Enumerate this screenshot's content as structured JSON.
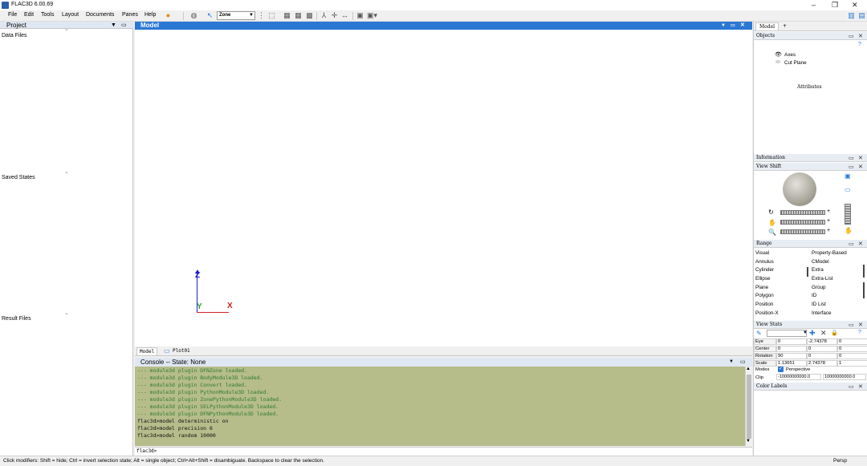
{
  "window": {
    "title": "FLAC3D 6.00.69"
  },
  "menu": [
    "File",
    "Edit",
    "Tools",
    "Layout",
    "Documents",
    "Panes",
    "Help"
  ],
  "toolbar": {
    "select_value": "Zone"
  },
  "project": {
    "title": "Project",
    "sections": [
      "Data Files",
      "Saved States",
      "Result Files"
    ]
  },
  "model": {
    "title": "Model",
    "axes": {
      "z": "Z",
      "y": "Y",
      "x": "X"
    },
    "colors": {
      "z": "#1a1ad8",
      "y": "#2ca02c",
      "x": "#d62020"
    }
  },
  "view_tabs": [
    "Model",
    "Plot01"
  ],
  "console": {
    "title": "Console -- State: None",
    "lines": [
      {
        "text": "--- module3d plugin DFNZone loaded.",
        "kind": "g"
      },
      {
        "text": "--- module3d plugin BodyModule3D loaded.",
        "kind": "g"
      },
      {
        "text": "--- module3d plugin Convert loaded.",
        "kind": "g"
      },
      {
        "text": "--- module3d plugin PythonModule3D loaded.",
        "kind": "g"
      },
      {
        "text": "--- module3d plugin ZonePythonModule3D loaded.",
        "kind": "g"
      },
      {
        "text": "--- module3d plugin SELPythonModule3D loaded.",
        "kind": "g"
      },
      {
        "text": "--- module3d plugin DFNPythonModule3D loaded.",
        "kind": "g"
      },
      {
        "text": "flac3d>model deterministic on",
        "kind": "k"
      },
      {
        "text": "flac3d>model precision 6",
        "kind": "k"
      },
      {
        "text": "flac3d>model random 10000",
        "kind": "k"
      }
    ],
    "prompt": "flac3d>"
  },
  "status": {
    "message": "Click modifiers: Shift = hide; Ctrl = invert selection state; Alt = single object; Ctrl+Alt+Shift = disambiguate.  Backspace to clear the selection.",
    "mode": "Persp"
  },
  "right": {
    "tabs": [
      "Model",
      "+"
    ],
    "objects": {
      "title": "Objects",
      "items": [
        "Axes",
        "Cut Plane"
      ],
      "attributes": "Attributes"
    },
    "information": {
      "title": "Information"
    },
    "view_shift": {
      "title": "View Shift"
    },
    "range": {
      "title": "Range",
      "left": [
        "Visual",
        "Annulus",
        "Cylinder",
        "Ellipse",
        "Plane",
        "Polygon",
        "Position",
        "Position-X"
      ],
      "right": [
        "Property-Based",
        "CModel",
        "Extra",
        "Extra-List",
        "Group",
        "ID",
        "ID List",
        "Interface"
      ]
    },
    "view_stats": {
      "title": "View Stats",
      "rows": [
        {
          "label": "Eye",
          "v": [
            "0",
            "-2.74378",
            "0"
          ]
        },
        {
          "label": "Center",
          "v": [
            "0",
            "0",
            "0"
          ]
        },
        {
          "label": "Rotation",
          "v": [
            "90",
            "0",
            "0"
          ]
        },
        {
          "label": "Scale",
          "v": [
            "1.13651",
            "2.74378",
            "1"
          ]
        }
      ],
      "modes_label": "Modes",
      "perspective": "Perspective",
      "clip_label": "Clip",
      "clip_values": [
        "-10000000000.0",
        "10000000000.0"
      ]
    },
    "color_labels": {
      "title": "Color Labels"
    }
  }
}
